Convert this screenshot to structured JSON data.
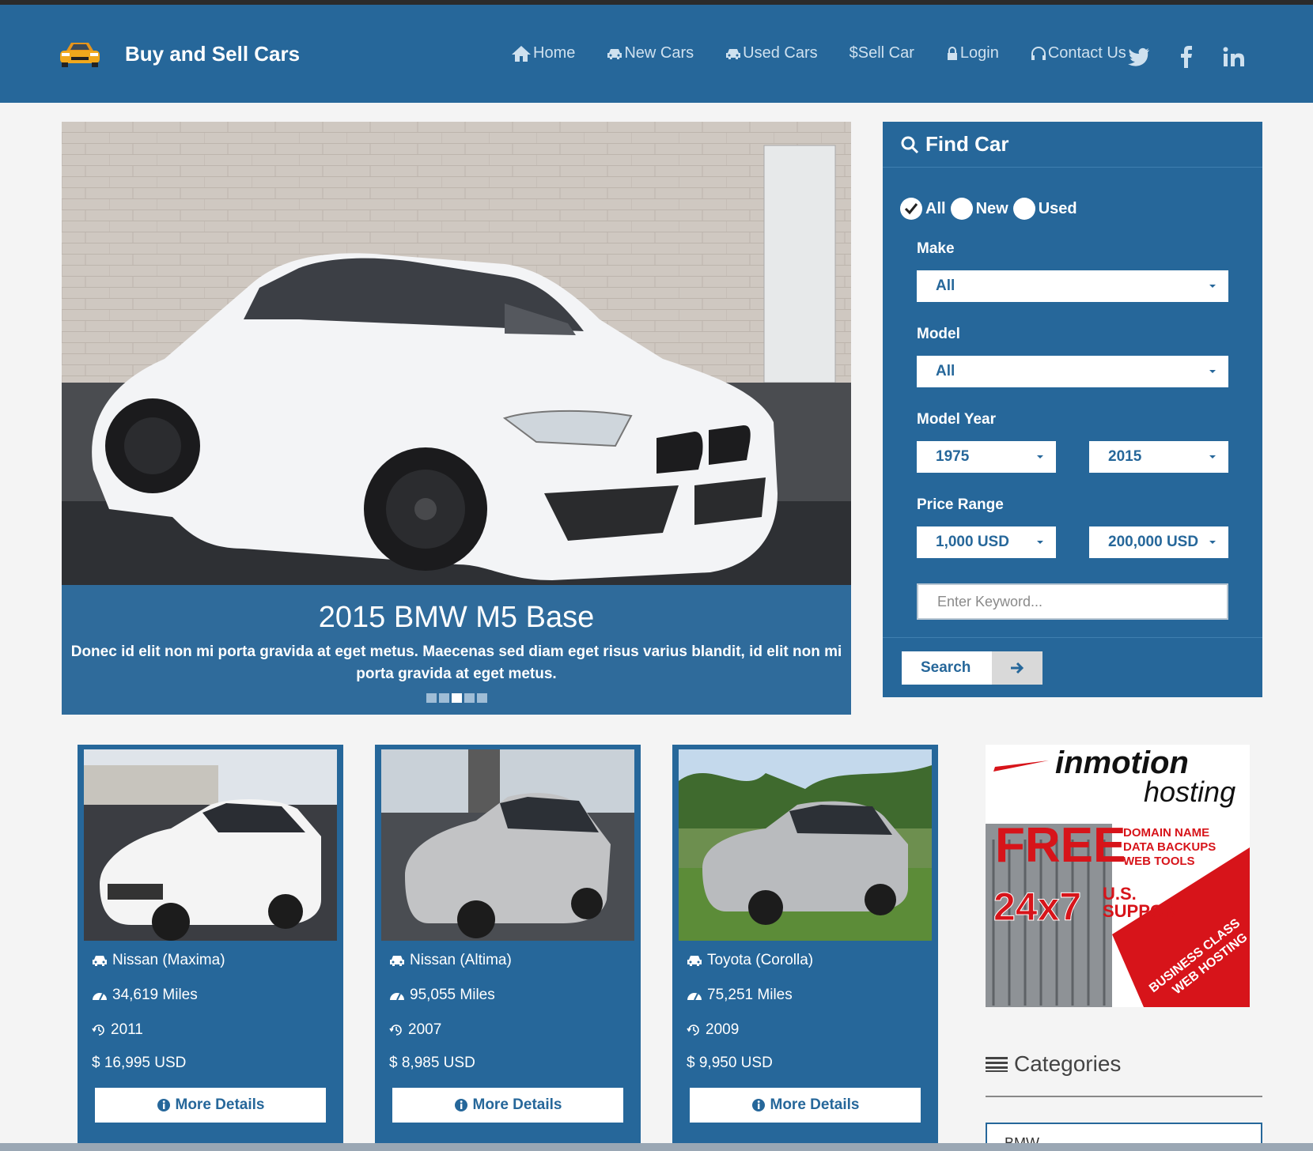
{
  "brand": {
    "name": "Buy and Sell Cars",
    "logo_icon": "car-logo-icon"
  },
  "nav": {
    "items": [
      {
        "label": "Home",
        "icon": "home-icon"
      },
      {
        "label": "New Cars",
        "icon": "car-icon"
      },
      {
        "label": "Used Cars",
        "icon": "car-icon"
      },
      {
        "label": "$Sell Car",
        "icon": ""
      },
      {
        "label": "Login",
        "icon": "lock-icon"
      },
      {
        "label": "Contact Us",
        "icon": "headset-icon"
      }
    ],
    "social": [
      "twitter-icon",
      "facebook-icon",
      "linkedin-icon"
    ]
  },
  "carousel": {
    "title": "2015 BMW M5 Base",
    "text": "Donec id elit non mi porta gravida at eget metus. Maecenas sed diam eget risus varius blandit, id elit non mi porta gravida at eget metus.",
    "slide_count": 5,
    "active_slide": 3
  },
  "find_car": {
    "title": "Find Car",
    "condition_options": [
      {
        "label": "All",
        "checked": true
      },
      {
        "label": "New",
        "checked": false
      },
      {
        "label": "Used",
        "checked": false
      }
    ],
    "make_label": "Make",
    "make_value": "All",
    "model_label": "Model",
    "model_value": "All",
    "year_label": "Model Year",
    "year_from": "1975",
    "year_to": "2015",
    "price_label": "Price Range",
    "price_from": "1,000 USD",
    "price_to": "200,000 USD",
    "keyword_placeholder": "Enter Keyword...",
    "search_label": "Search"
  },
  "cars": [
    {
      "name": "Nissan (Maxima)",
      "miles": "34,619 Miles",
      "year": "2011",
      "price": "$ 16,995 USD",
      "button": "More Details",
      "color": "#f2f2f2"
    },
    {
      "name": "Nissan (Altima)",
      "miles": "95,055 Miles",
      "year": "2007",
      "price": "$ 8,985 USD",
      "button": "More Details",
      "color": "#b9babb"
    },
    {
      "name": "Toyota (Corolla)",
      "miles": "75,251 Miles",
      "year": "2009",
      "price": "$ 9,950 USD",
      "button": "More Details",
      "color": "#b4b6b8"
    }
  ],
  "ad": {
    "brand_line1": "inmotion",
    "brand_line2": "hosting",
    "free": "FREE",
    "features": [
      "DOMAIN NAME",
      "DATA BACKUPS",
      "WEB TOOLS"
    ],
    "support_big": "24x7",
    "support_small_1": "U.S.",
    "support_small_2": "SUPPORT",
    "banner_1": "BUSINESS CLASS",
    "banner_2": "WEB HOSTING"
  },
  "categories": {
    "title": "Categories",
    "items": [
      "BMW"
    ]
  },
  "colors": {
    "primary": "#26679a",
    "background": "#f4f4f4",
    "ad_red": "#d7141a"
  }
}
